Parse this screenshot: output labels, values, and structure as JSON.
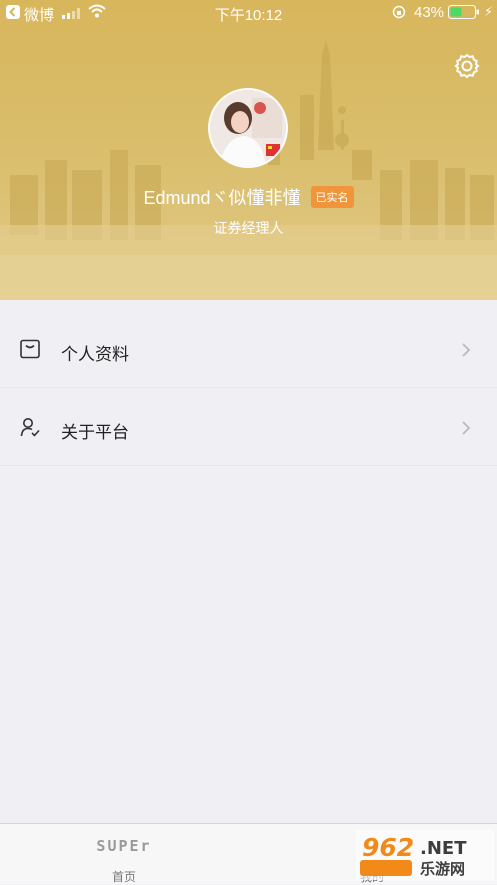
{
  "status_bar": {
    "back_app": "微博",
    "time": "下午10:12",
    "battery": "43%"
  },
  "profile": {
    "name": "Edmundヾ似懂非懂",
    "badge": "已实名",
    "role": "证券经理人"
  },
  "menu": {
    "items": [
      {
        "label": "个人资料",
        "icon": "profile-card-icon"
      },
      {
        "label": "关于平台",
        "icon": "user-check-icon"
      }
    ]
  },
  "tabbar": {
    "home_logo": "SUPEr",
    "home_label": "首页",
    "mine_label": "我的"
  },
  "watermark": {
    "brand": "962",
    "suffix": ".NET",
    "name": "乐游网"
  },
  "colors": {
    "header_gold": "#d9bd6a",
    "badge_orange": "#f0953a",
    "background": "#efeff4"
  }
}
